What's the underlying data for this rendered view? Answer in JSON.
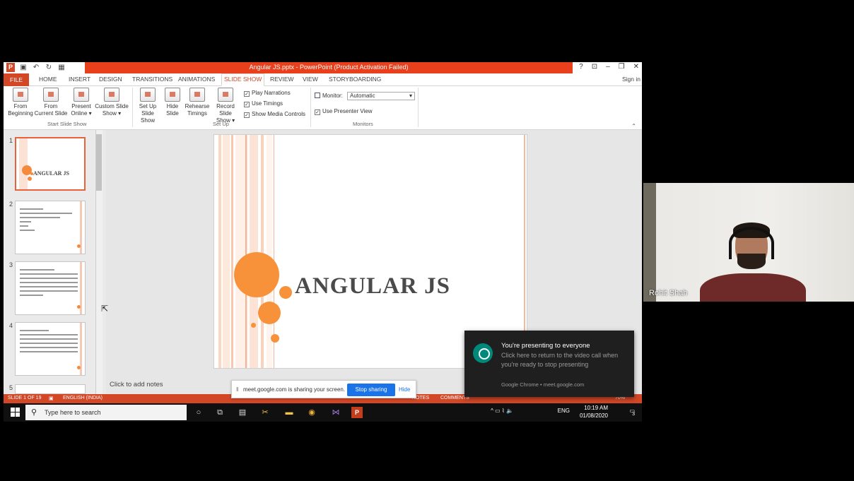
{
  "window": {
    "title": "Angular JS.pptx - PowerPoint (Product Activation Failed)",
    "controls": [
      "?",
      "⊡",
      "–",
      "❐",
      "✕"
    ]
  },
  "qat": {
    "icons": [
      "powerpoint-icon",
      "save-icon",
      "undo-icon",
      "redo-icon",
      "slideshow-icon"
    ]
  },
  "tabs": {
    "file": "FILE",
    "items": [
      "HOME",
      "INSERT",
      "DESIGN",
      "TRANSITIONS",
      "ANIMATIONS",
      "SLIDE SHOW",
      "REVIEW",
      "VIEW",
      "STORYBOARDING"
    ],
    "active": "SLIDE SHOW",
    "signin": "Sign in"
  },
  "ribbon": {
    "start_group": "Start Slide Show",
    "setup_group": "Set Up",
    "monitors_group": "Monitors",
    "buttons": {
      "from_beginning": [
        "From",
        "Beginning"
      ],
      "from_current": [
        "From",
        "Current Slide"
      ],
      "present_online": [
        "Present",
        "Online ▾"
      ],
      "custom_show": [
        "Custom Slide",
        "Show ▾"
      ],
      "setup_show": [
        "Set Up",
        "Slide Show"
      ],
      "hide_slide": [
        "Hide",
        "Slide"
      ],
      "rehearse": [
        "Rehearse",
        "Timings"
      ],
      "record": [
        "Record Slide",
        "Show ▾"
      ]
    },
    "checks": {
      "narrations": "Play Narrations",
      "timings": "Use Timings",
      "media": "Show Media Controls",
      "presenter": "Use Presenter View"
    },
    "monitor_label": "Monitor:",
    "monitor_value": "Automatic"
  },
  "thumbnails": {
    "numbers": [
      "1",
      "2",
      "3",
      "4",
      "5"
    ],
    "slide1_title": "ANGULAR JS"
  },
  "slide": {
    "title": "ANGULAR JS"
  },
  "notes": "Click to add notes",
  "status": {
    "slide": "SLIDE 1 OF 19",
    "language": "ENGLISH (INDIA)",
    "notes": "NOTES",
    "comments": "COMMENTS",
    "zoom": "70%"
  },
  "sharebar": {
    "message": "meet.google.com is sharing your screen.",
    "stop": "Stop sharing",
    "hide": "Hide"
  },
  "taskbar": {
    "search_placeholder": "Type here to search",
    "lang": "ENG",
    "time": "10:19 AM",
    "date": "01/08/2020",
    "notif_count": "3"
  },
  "notification": {
    "title": "You're presenting to everyone",
    "body": "Click here to return to the video call when you're ready to stop presenting",
    "source": "Google Chrome • meet.google.com"
  },
  "participant": {
    "name": "Rohit Shah"
  },
  "colors": {
    "accent": "#d24726",
    "slide_orange": "#f7923a",
    "meet_blue": "#1a73e8"
  }
}
